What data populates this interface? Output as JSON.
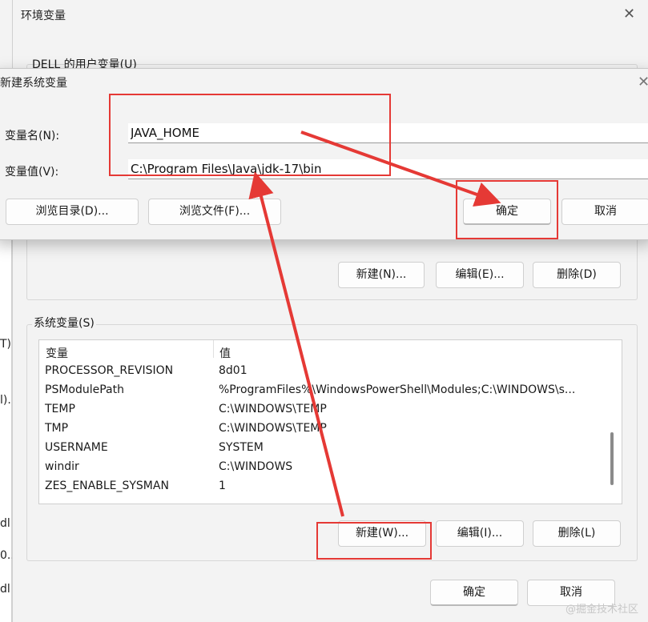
{
  "env_window": {
    "title": "环境变量",
    "close_glyph": "✕",
    "user_group_label": "DELL 的用户变量(U)",
    "user_buttons": {
      "new": "新建(N)...",
      "edit": "编辑(E)...",
      "delete": "删除(D)"
    },
    "system_group_label": "系统变量(S)",
    "system_list": {
      "headers": {
        "name": "变量",
        "value": "值"
      },
      "rows": [
        {
          "name": "PROCESSOR_REVISION",
          "value": "8d01"
        },
        {
          "name": "PSModulePath",
          "value": "%ProgramFiles%\\WindowsPowerShell\\Modules;C:\\WINDOWS\\s..."
        },
        {
          "name": "TEMP",
          "value": "C:\\WINDOWS\\TEMP"
        },
        {
          "name": "TMP",
          "value": "C:\\WINDOWS\\TEMP"
        },
        {
          "name": "USERNAME",
          "value": "SYSTEM"
        },
        {
          "name": "windir",
          "value": "C:\\WINDOWS"
        },
        {
          "name": "ZES_ENABLE_SYSMAN",
          "value": "1"
        }
      ]
    },
    "system_buttons": {
      "new": "新建(W)...",
      "edit": "编辑(I)...",
      "delete": "删除(L)"
    },
    "footer_buttons": {
      "ok": "确定",
      "cancel": "取消"
    }
  },
  "left_strip": {
    "items": [
      "T)..",
      "l)...",
      "dl",
      "0..",
      "dl"
    ]
  },
  "new_dialog": {
    "title": "新建系统变量",
    "close_glyph": "✕",
    "name_label": "变量名(N):",
    "name_value": "JAVA_HOME",
    "value_label": "变量值(V):",
    "value_value": "C:\\Program Files\\Java\\jdk-17\\bin",
    "browse_dir": "浏览目录(D)...",
    "browse_file": "浏览文件(F)...",
    "ok": "确定",
    "cancel": "取消"
  },
  "annotation_color": "#e53935",
  "watermark": "@掘金技术社区"
}
